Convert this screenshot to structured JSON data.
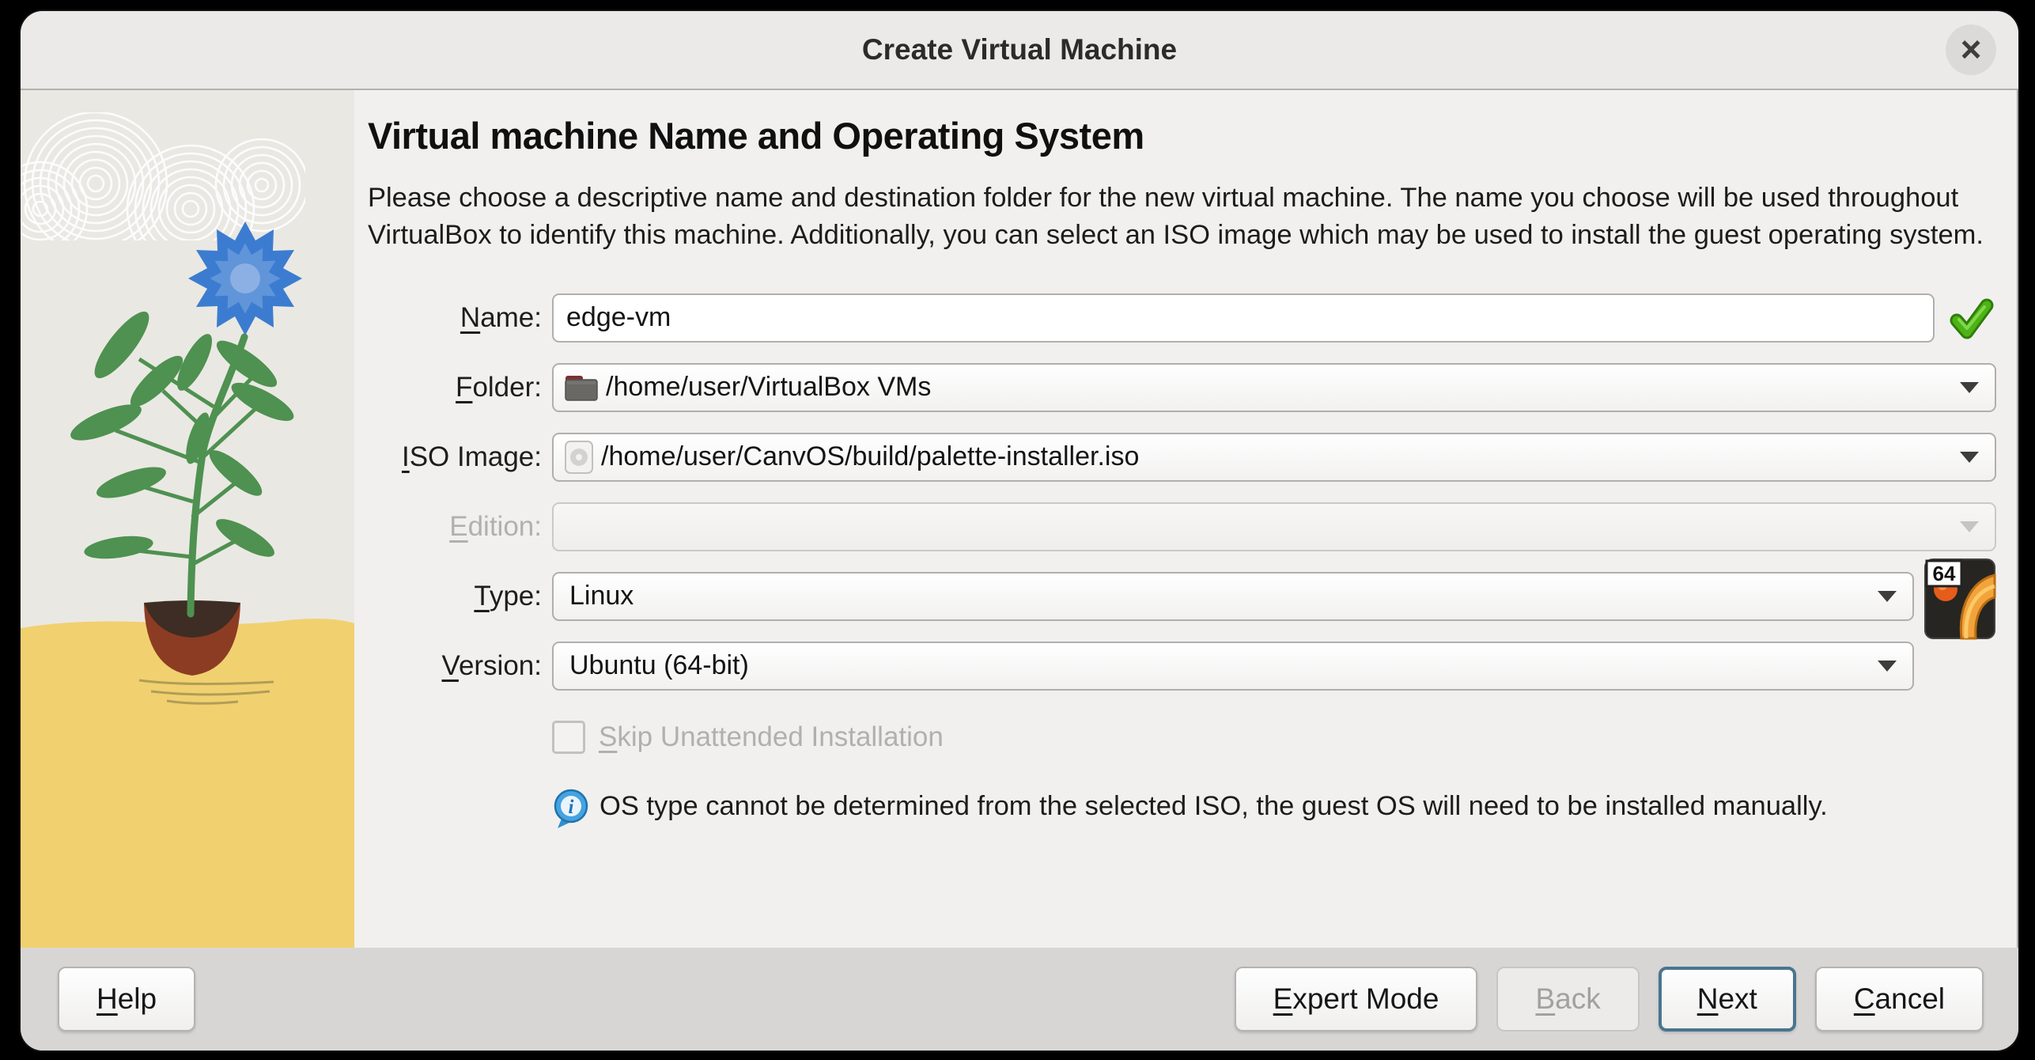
{
  "window": {
    "title": "Create Virtual Machine",
    "close_glyph": "×"
  },
  "page": {
    "heading": "Virtual machine Name and Operating System",
    "description": "Please choose a descriptive name and destination folder for the new virtual machine. The name you choose will be used throughout VirtualBox to identify this machine. Additionally, you can select an ISO image which may be used to install the guest operating system."
  },
  "form": {
    "name": {
      "label": {
        "u": "N",
        "post": "ame:"
      },
      "value": "edge-vm"
    },
    "folder": {
      "label": {
        "u": "F",
        "post": "older:"
      },
      "value": "/home/user/VirtualBox VMs"
    },
    "iso": {
      "label": {
        "u": "I",
        "post": "SO Image:"
      },
      "value": "/home/user/CanvOS/build/palette-installer.iso"
    },
    "edition": {
      "label": {
        "u": "E",
        "post": "dition:"
      },
      "value": ""
    },
    "type": {
      "label": {
        "u": "T",
        "post": "ype:"
      },
      "value": "Linux",
      "badge": "64"
    },
    "version": {
      "label": {
        "u": "V",
        "post": "ersion:"
      },
      "value": "Ubuntu (64-bit)"
    },
    "skip_unattended": {
      "label": {
        "u": "S",
        "post": "kip Unattended Installation"
      },
      "checked": false
    },
    "info_glyph": "i",
    "info_text": "OS type cannot be determined from the selected ISO, the guest OS will need to be installed manually."
  },
  "buttons": {
    "help": {
      "u": "H",
      "post": "elp"
    },
    "expert": {
      "u": "E",
      "post": "xpert Mode"
    },
    "back": {
      "u": "B",
      "post": "ack"
    },
    "next": {
      "u": "N",
      "post": "ext"
    },
    "cancel": {
      "u": "C",
      "post": "ancel"
    }
  },
  "colors": {
    "flower_blue": "#3c7cd0",
    "ground_yellow": "#f1d06f",
    "pot_red": "#8c3c22",
    "leaf_green": "#4e9150",
    "check_green": "#4db316",
    "info_blue": "#3498db",
    "next_border_blue": "#49758f"
  }
}
